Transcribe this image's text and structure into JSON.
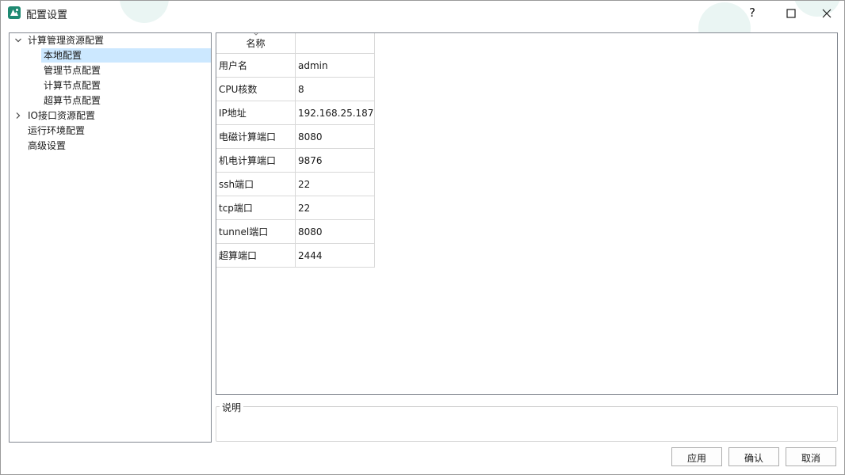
{
  "window": {
    "title": "配置设置",
    "help_glyph": "?"
  },
  "tree": {
    "items": [
      {
        "label": "计算管理资源配置",
        "expander": "chevron-down-icon"
      },
      {
        "label": "本地配置",
        "selected": true
      },
      {
        "label": "管理节点配置"
      },
      {
        "label": "计算节点配置"
      },
      {
        "label": "超算节点配置"
      },
      {
        "label": "IO接口资源配置",
        "expander": "chevron-right-icon"
      },
      {
        "label": "运行环境配置"
      },
      {
        "label": "高级设置"
      }
    ]
  },
  "grid": {
    "header": [
      "名称",
      ""
    ],
    "rows": [
      {
        "key": "用户名",
        "value": "admin"
      },
      {
        "key": "CPU核数",
        "value": "8"
      },
      {
        "key": "IP地址",
        "value": "192.168.25.187"
      },
      {
        "key": "电磁计算端口",
        "value": "8080"
      },
      {
        "key": "机电计算端口",
        "value": "9876"
      },
      {
        "key": "ssh端口",
        "value": "22"
      },
      {
        "key": "tcp端口",
        "value": "22"
      },
      {
        "key": "tunnel端口",
        "value": "8080"
      },
      {
        "key": "超算端口",
        "value": "2444"
      }
    ]
  },
  "description": {
    "label": "说明"
  },
  "buttons": {
    "apply": "应用",
    "ok": "确认",
    "cancel": "取消"
  },
  "colors": {
    "app_icon": "#1f8a72",
    "selection": "#cce8ff",
    "border": "#828790"
  }
}
